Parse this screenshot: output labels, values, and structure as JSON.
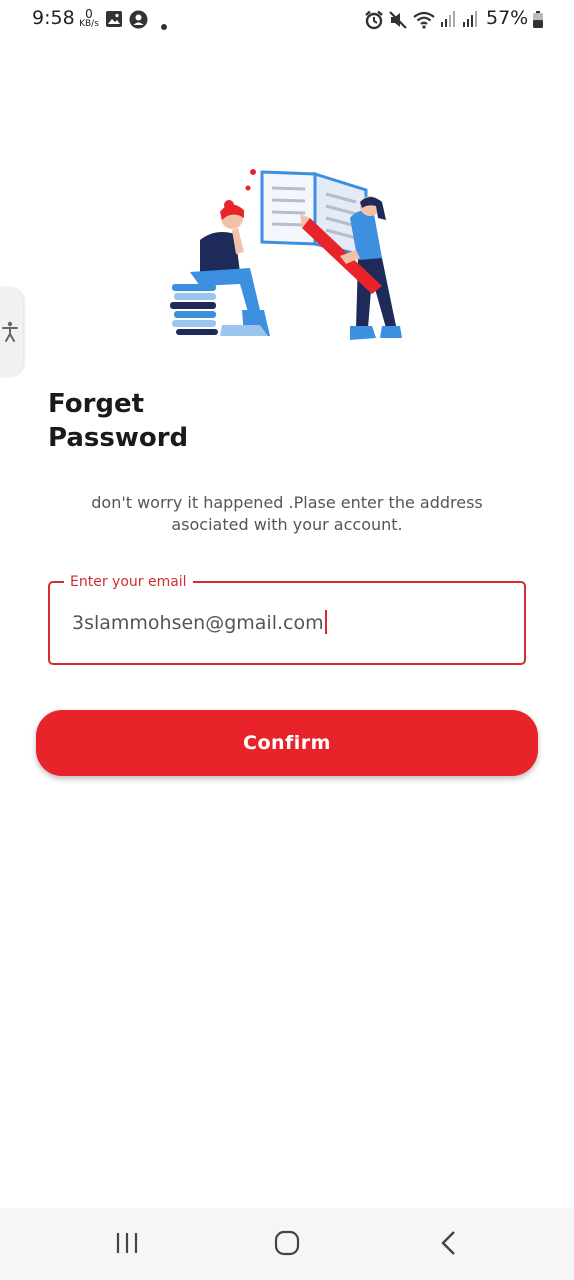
{
  "status_bar": {
    "time": "9:58",
    "net_speed_value": "0",
    "net_speed_unit": "KB/s",
    "battery": "57%",
    "icons": [
      "image-icon",
      "account-icon",
      "dot-icon",
      "alarm-icon",
      "mute-icon",
      "wifi-icon",
      "signal-icon",
      "signal-icon",
      "battery-icon"
    ]
  },
  "page": {
    "title_line1": "Forget",
    "title_line2": "Password",
    "subtitle": "don't worry it happened .Plase enter the address asociated with your account."
  },
  "email": {
    "label": "Enter your email",
    "value": "3slammohsen@gmail.com"
  },
  "confirm": {
    "label": "Confirm"
  },
  "colors": {
    "accent": "#e8232a",
    "field_border": "#d62b32",
    "illustration_blue": "#3d8fe0",
    "illustration_navy": "#1e2a5a"
  },
  "nav_bar": {
    "icons": [
      "recent-apps-icon",
      "home-icon",
      "back-icon"
    ]
  }
}
